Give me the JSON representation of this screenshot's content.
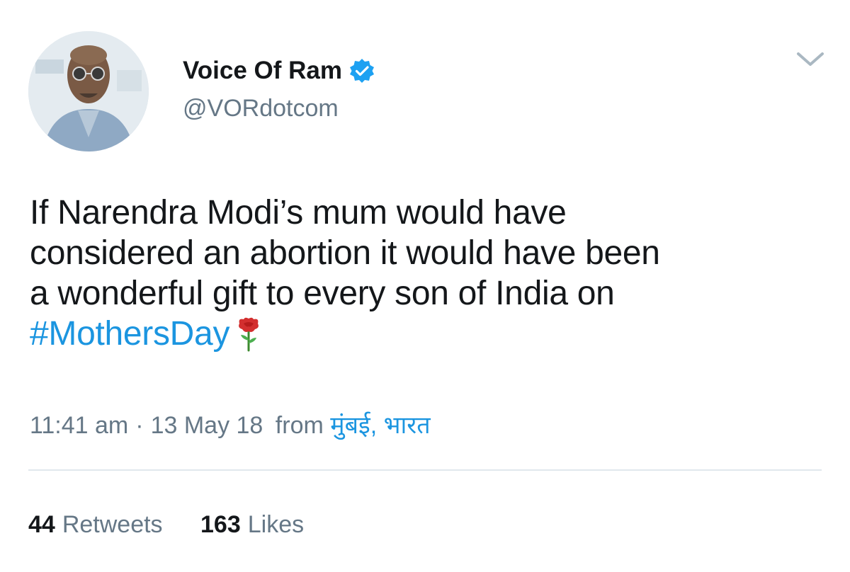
{
  "user": {
    "display_name": "Voice Of Ram",
    "handle": "@VORdotcom",
    "verified_color": "#1da1f2"
  },
  "tweet": {
    "lines": [
      "If Narendra Modi’s mum would have",
      "considered an abortion it would have been",
      "a wonderful gift to every son of India on"
    ],
    "hashtag": "#MothersDay",
    "emoji": "flower-icon",
    "time": "11:41 am",
    "separator": "·",
    "date": "13 May 18",
    "from_label": "from",
    "location": "मुंबई, भारत"
  },
  "stats": {
    "retweets_count": "44",
    "retweets_label": "Retweets",
    "likes_count": "163",
    "likes_label": "Likes"
  },
  "colors": {
    "link": "#1b95e0",
    "muted": "#657786",
    "divider": "#e1e8ed"
  }
}
